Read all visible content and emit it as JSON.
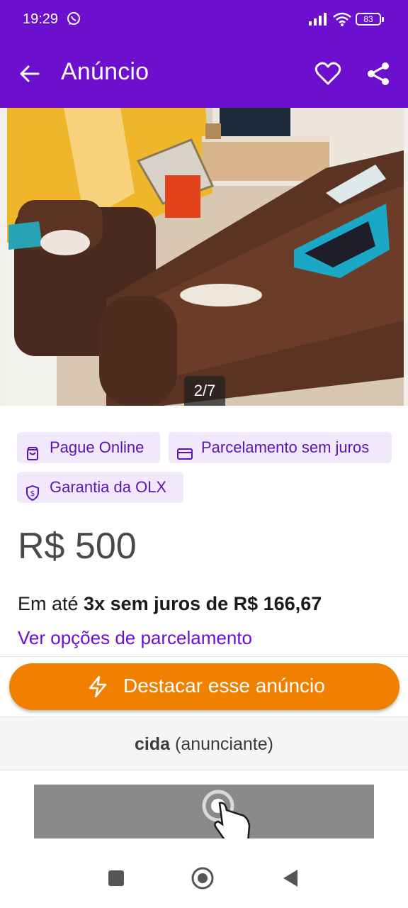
{
  "status_bar": {
    "time": "19:29",
    "battery": "83",
    "icons": [
      "whatsapp-icon",
      "signal-icon",
      "wifi-icon",
      "battery-icon"
    ]
  },
  "app_bar": {
    "title": "Anúncio",
    "icons": [
      "back-arrow-icon",
      "heart-icon",
      "share-icon"
    ]
  },
  "gallery": {
    "counter": "2/7"
  },
  "badges": [
    {
      "label": "Pague Online",
      "icon": "bag-icon"
    },
    {
      "label": "Parcelamento sem juros",
      "icon": "card-icon"
    },
    {
      "label": "Garantia da OLX",
      "icon": "shield-dollar-icon"
    }
  ],
  "price": "R$ 500",
  "installments": {
    "prefix": "Em até ",
    "bold": "3x sem juros de R$ 166,67",
    "link": "Ver opções de parcelamento"
  },
  "highlight_button": {
    "label": "Destacar esse anúncio",
    "icon": "lightning-icon"
  },
  "seller": {
    "name": "cida",
    "role": " (anunciante)"
  },
  "navigation_bar": {
    "icons": [
      "recents-square-icon",
      "home-circle-icon",
      "back-triangle-icon"
    ]
  },
  "colors": {
    "brand_purple": "#6c0fcf",
    "badge_bg": "#f1e8fb",
    "badge_text": "#5b14b4",
    "accent_orange": "#f28000"
  }
}
